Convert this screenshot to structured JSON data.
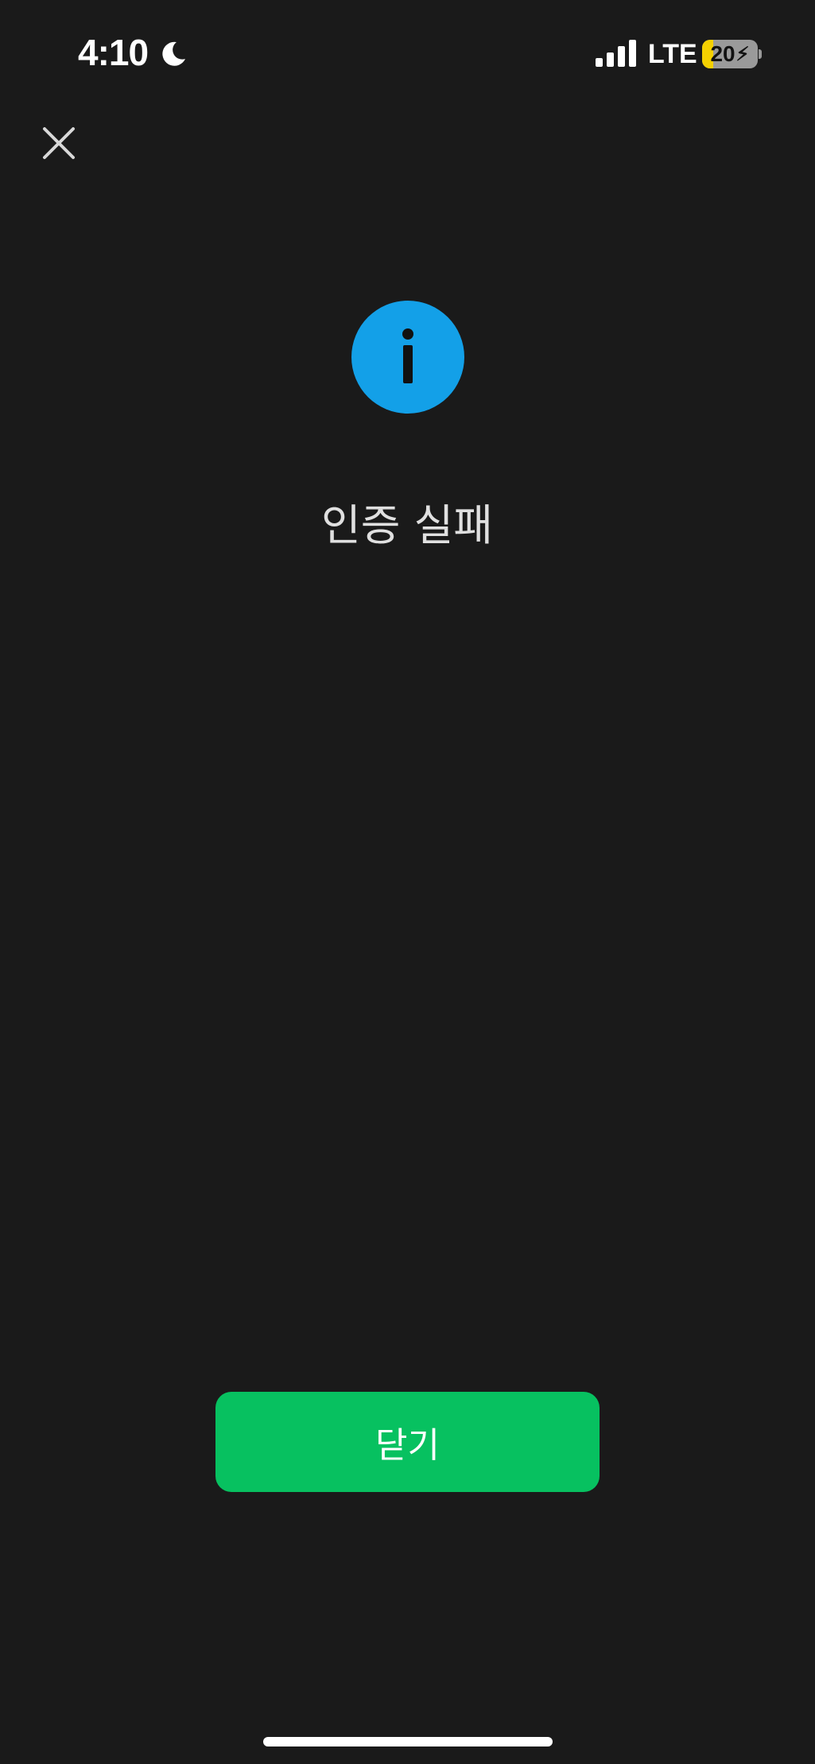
{
  "status_bar": {
    "time": "4:10",
    "network": "LTE",
    "battery_level_text": "20",
    "battery_fraction": 0.2,
    "battery_fill_color": "#f5d100",
    "icons": {
      "do_not_disturb": "moon-icon",
      "signal": "signal-icon",
      "charging": "bolt-icon"
    }
  },
  "header": {
    "close_icon": "close-icon"
  },
  "result": {
    "icon": "info-icon",
    "icon_color": "#13a0e8",
    "title": "인증 실패"
  },
  "footer": {
    "close_button_label": "닫기",
    "button_color": "#07c160"
  }
}
